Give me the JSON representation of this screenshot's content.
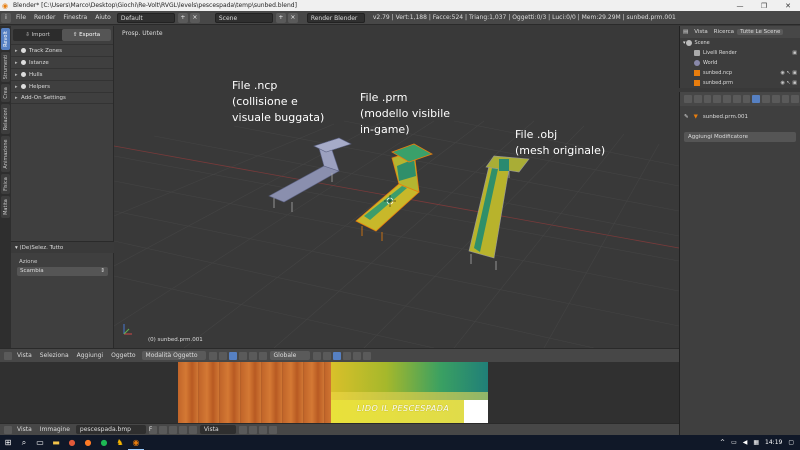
{
  "titlebar": {
    "title": "Blender* [C:\\Users\\Marco\\Desktop\\Giochi\\Re-Volt\\RVGL\\levels\\pescespada\\temp\\sunbed.blend]",
    "minimize": "—",
    "maximize": "❐",
    "close": "✕"
  },
  "infobar": {
    "menus": [
      "File",
      "Render",
      "Finestra",
      "Aiuto"
    ],
    "layout": "Default",
    "scene": "Scene",
    "engine": "Render Blender",
    "stats": "v2.79 | Vert:1,188 | Facce:524 | Triang:1,037 | Oggetti:0/3 | Luci:0/0 | Mem:29.29M | sunbed.prm.001"
  },
  "vtabs": [
    "Revolt",
    "Strumenti",
    "Crea",
    "Relazioni",
    "Animazione",
    "Fisica",
    "Matita"
  ],
  "toolshelf": {
    "tab_import": "Import",
    "tab_export": "Esporta",
    "panels": [
      "Track Zones",
      "Istanze",
      "Hulls",
      "Helpers",
      "Add-On Settings"
    ],
    "operator": {
      "title": "(De)Selez. Tutto",
      "label": "Azione",
      "value": "Scambia"
    }
  },
  "viewport": {
    "label": "Prosp. Utente",
    "object_name": "(0) sunbed.prm.001",
    "annotations": [
      "File .ncp\n(collisione e\nvisuale buggata)",
      "File .prm\n(modello visibile\nin-game)",
      "File .obj\n(mesh originale)"
    ]
  },
  "vp_header": {
    "items": [
      "Vista",
      "Seleziona",
      "Aggiungi",
      "Oggetto"
    ],
    "mode": "Modalità Oggetto",
    "orientation": "Globale"
  },
  "image_editor": {
    "banner_text": "LIDO IL PESCESPADA"
  },
  "img_header": {
    "items": [
      "Vista",
      "Immagine"
    ],
    "image_name": "pescespada.bmp",
    "f_label": "F",
    "view": "Vista"
  },
  "outliner": {
    "tabs": [
      "Vista",
      "Ricerca",
      "Tutte Le Scene"
    ],
    "rows": [
      "Scene",
      "Livelli Render",
      "World",
      "sunbed.ncp",
      "sunbed.prm"
    ]
  },
  "properties": {
    "object": "sunbed.prm.001",
    "add_modifier": "Aggiungi Modificatore"
  },
  "taskbar": {
    "time": "14:19"
  },
  "colors": {
    "accent": "#5680c2",
    "object_orange": "#e87d0d"
  }
}
